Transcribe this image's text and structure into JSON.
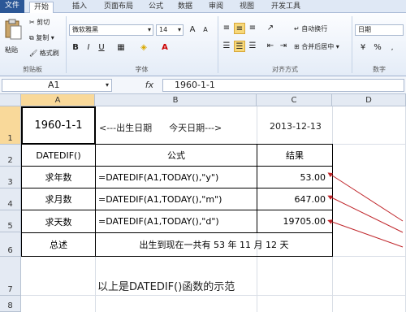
{
  "tabs": [
    "文件",
    "开始",
    "插入",
    "页面布局",
    "公式",
    "数据",
    "审阅",
    "视图",
    "开发工具"
  ],
  "ribbon": {
    "clipboard": {
      "cut": "剪切",
      "copy": "复制",
      "format_painter": "格式刷",
      "paste": "粘贴",
      "label": "剪贴板"
    },
    "font": {
      "name": "微软雅黑",
      "size": "14",
      "bold": "B",
      "italic": "I",
      "underline": "U",
      "label": "字体"
    },
    "alignment": {
      "wrap": "自动换行",
      "merge": "合并后居中",
      "label": "对齐方式"
    },
    "number": {
      "format": "日期",
      "percent": "%",
      "label": "数字"
    }
  },
  "formula_bar": {
    "name_box": "A1",
    "fx": "fx",
    "value": "1960-1-1"
  },
  "columns": [
    "A",
    "B",
    "C",
    "D"
  ],
  "rows": [
    "1",
    "2",
    "3",
    "4",
    "5",
    "6",
    "7",
    "8"
  ],
  "sheet": {
    "a1": "1960-1-1",
    "b1": "<---出生日期      今天日期--->",
    "c1": "2013-12-13",
    "header": {
      "a": "DATEDIF()",
      "b": "公式",
      "c": "结果"
    },
    "rows": [
      {
        "a": "求年数",
        "b": "=DATEDIF(A1,TODAY(),\"y\")",
        "c": "53.00"
      },
      {
        "a": "求月数",
        "b": "=DATEDIF(A1,TODAY(),\"m\")",
        "c": "647.00"
      },
      {
        "a": "求天数",
        "b": "=DATEDIF(A1,TODAY(),\"d\")",
        "c": "19705.00"
      }
    ],
    "summary_label": "总述",
    "summary_text": "出生到现在一共有 53 年 11 月 12 天",
    "caption": "以上是DATEDIF()函数的示范"
  },
  "colors": {
    "file_tab": "#2b5797",
    "selected_header": "#f9d99a",
    "arrow": "#c0262b"
  }
}
